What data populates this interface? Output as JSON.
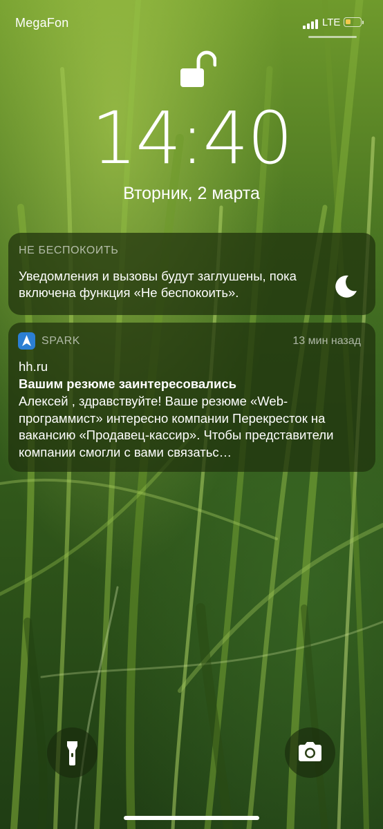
{
  "status_bar": {
    "carrier": "MegaFon",
    "network": "LTE",
    "signal_bars": 4,
    "battery_level": 0.35,
    "battery_color": "#f2c94c"
  },
  "lock_state_icon": "unlocked-padlock-icon",
  "lockscreen": {
    "time": "14:40",
    "date": "Вторник, 2 марта"
  },
  "do_not_disturb": {
    "title": "НЕ БЕСПОКОИТЬ",
    "message": "Уведомления и вызовы будут заглушены, пока включена функция «Не беспокоить».",
    "icon": "moon-icon"
  },
  "notification": {
    "app_name": "SPARK",
    "app_icon": "spark-icon",
    "app_icon_color": "#2b7fd3",
    "time": "13 мин назад",
    "sender": "hh.ru",
    "subject": "Вашим резюме заинтересовались",
    "preview": "Алексей , здравствуйте! Ваше резюме «Web-программист» интересно компании Перекресток на вакансию «Продавец-кассир». Чтобы представители компании смогли с вами связатьс…"
  },
  "quick_actions": {
    "left_icon": "flashlight-icon",
    "right_icon": "camera-icon"
  },
  "colors": {
    "card_background": "rgba(30, 48, 12, 0.72)",
    "secondary_text": "rgba(255,255,255,0.62)"
  }
}
